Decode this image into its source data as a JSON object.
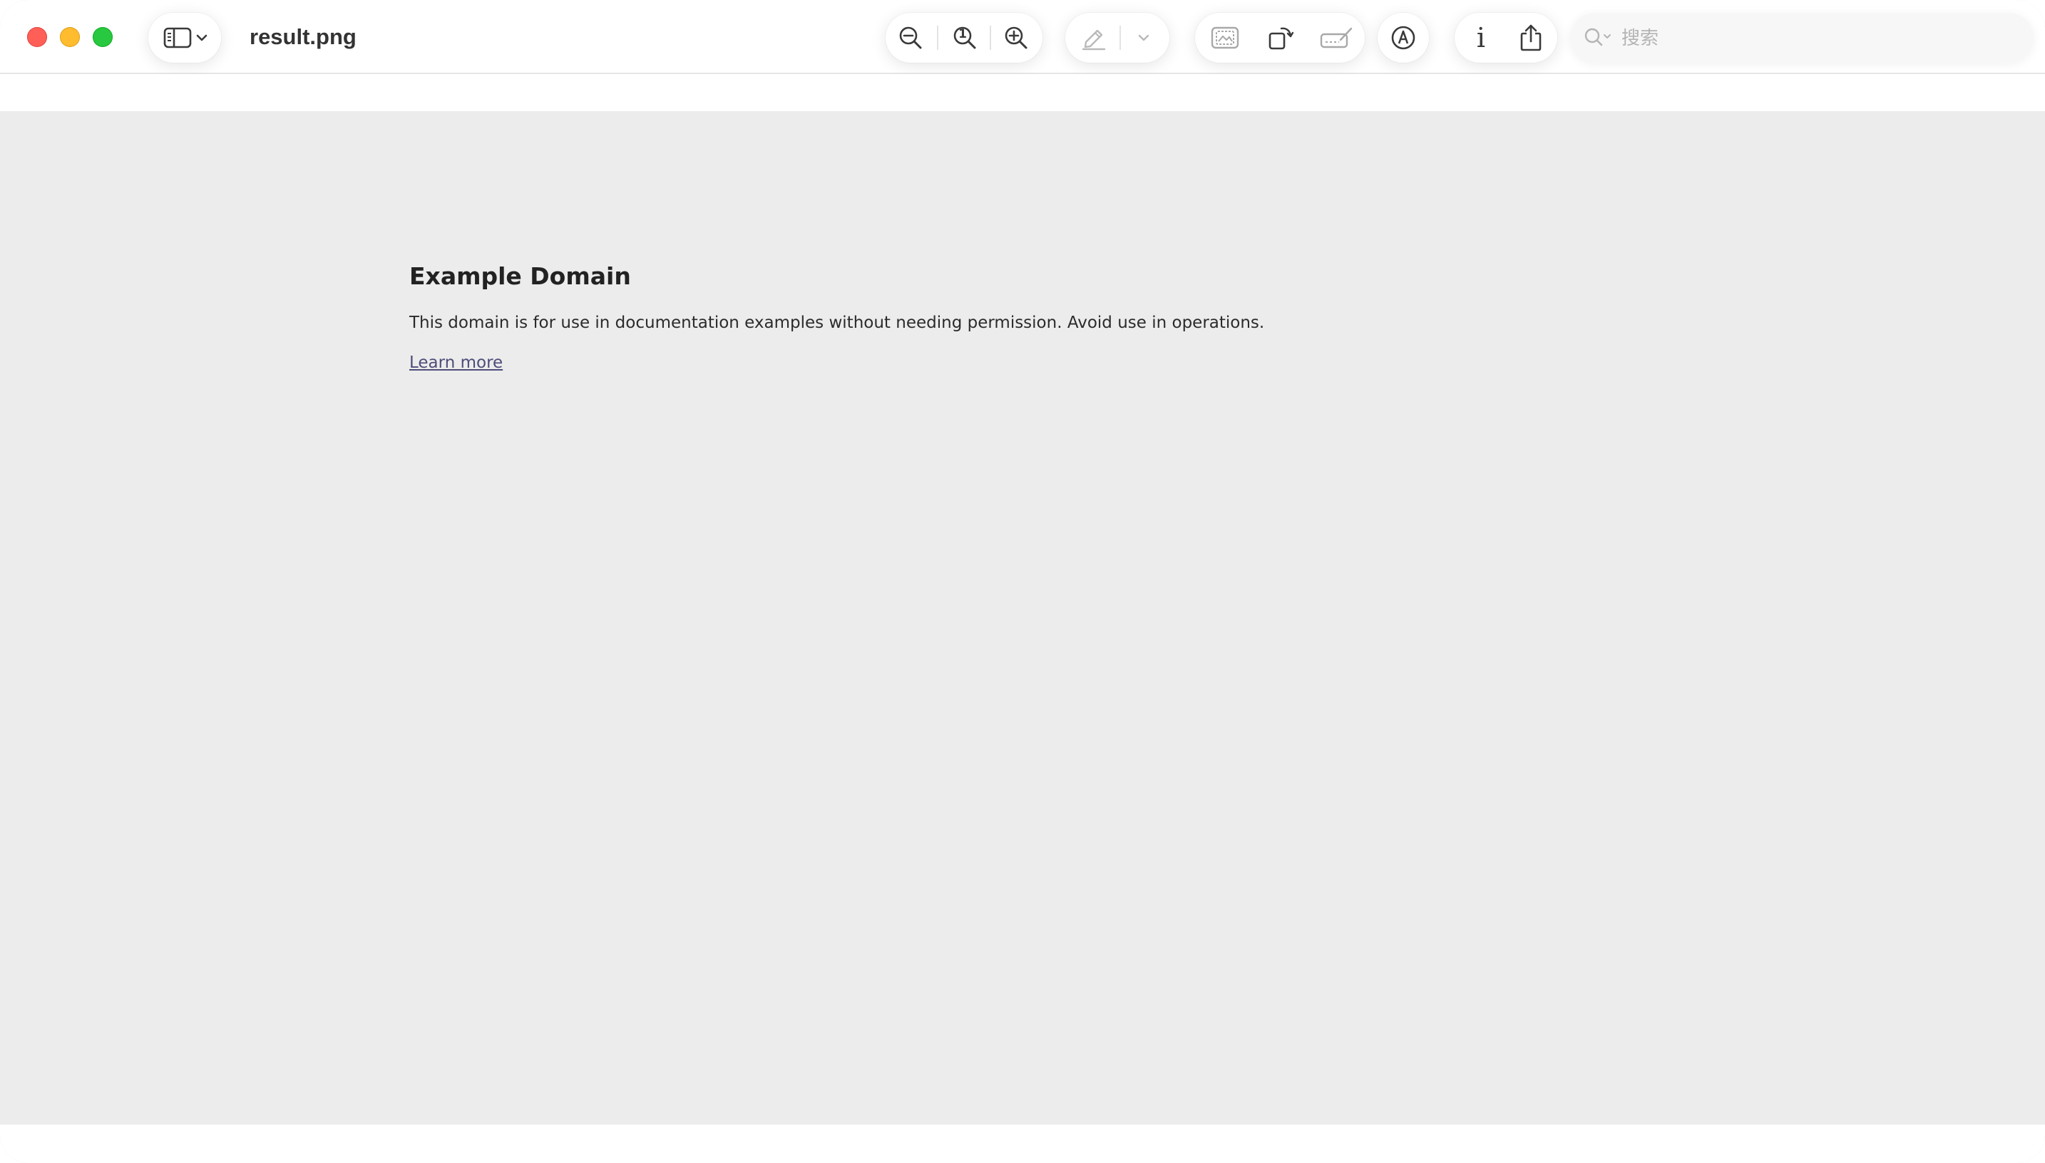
{
  "window": {
    "title": "result.png"
  },
  "toolbar": {
    "sidebar_toggle": {
      "icon": "sidebar-icon",
      "chevron": "chevron-down-icon"
    },
    "zoom": {
      "zoom_out_icon": "zoom-out-icon",
      "actual_size_icon": "actual-size-icon",
      "actual_size_glyph": "1",
      "zoom_in_icon": "zoom-in-icon"
    },
    "highlight": {
      "icon": "highlight-pen-icon",
      "chevron": "chevron-down-icon"
    },
    "edit": {
      "crop_icon": "crop-image-icon",
      "rotate_icon": "rotate-icon",
      "sign_icon": "signature-icon"
    },
    "markup_icon": "markup-icon",
    "info": {
      "icon": "info-icon",
      "glyph": "i"
    },
    "share_icon": "share-icon",
    "search": {
      "placeholder": "搜索",
      "value": "",
      "icon": "search-icon"
    }
  },
  "page": {
    "heading": "Example Domain",
    "text": "This domain is for use in documentation examples without needing permission. Avoid use in operations.",
    "link": "Learn more"
  },
  "colors": {
    "close": "#ff5f57",
    "minimize": "#febc2e",
    "maximize": "#28c840",
    "content_background": "#ececec",
    "link": "#4d4d7a"
  }
}
